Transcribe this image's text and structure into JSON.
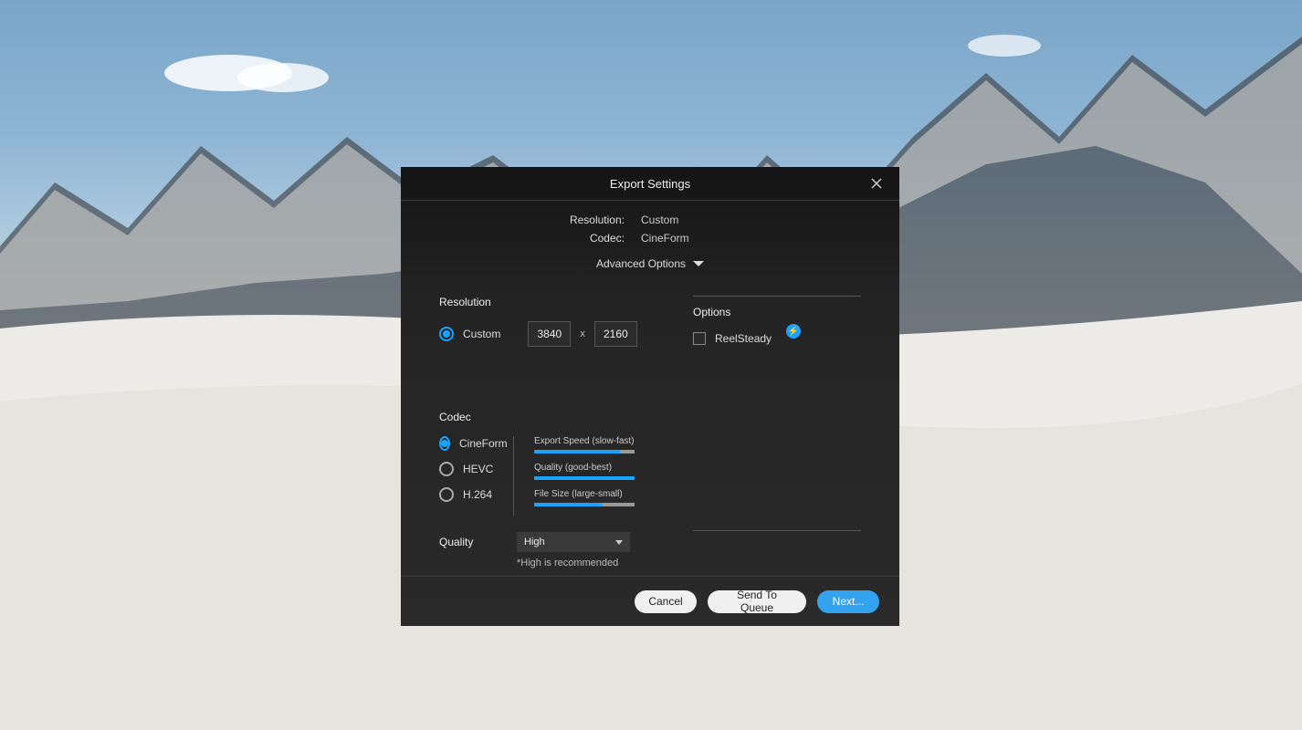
{
  "dialog": {
    "title": "Export Settings",
    "summary": {
      "resolution_label": "Resolution:",
      "resolution_value": "Custom",
      "codec_label": "Codec:",
      "codec_value": "CineForm"
    },
    "advanced_toggle": "Advanced Options",
    "resolution": {
      "heading": "Resolution",
      "custom_label": "Custom",
      "width": "3840",
      "height": "2160",
      "x": "x"
    },
    "options": {
      "heading": "Options",
      "reelsteady": "ReelSteady"
    },
    "codec": {
      "heading": "Codec",
      "choices": {
        "cineform": "CineForm",
        "hevc": "HEVC",
        "h264": "H.264"
      },
      "meters": {
        "export_speed": {
          "label": "Export Speed (slow-fast)",
          "fill": 85
        },
        "quality": {
          "label": "Quality (good-best)",
          "fill": 100
        },
        "file_size": {
          "label": "File Size (large-small)",
          "fill": 68
        }
      }
    },
    "quality": {
      "heading": "Quality",
      "selected": "High",
      "note": "*High is recommended"
    },
    "footer": {
      "cancel": "Cancel",
      "queue": "Send To Queue",
      "next": "Next..."
    }
  }
}
